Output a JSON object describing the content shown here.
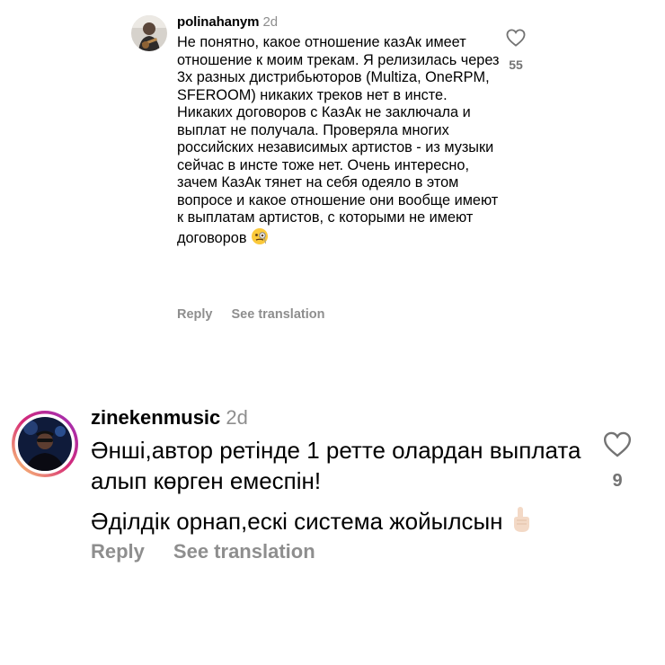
{
  "comments": [
    {
      "username": "polinahanym",
      "time": "2d",
      "text": "Не понятно, какое отношение казАк имеет отношение к моим трекам. Я релизилась через 3х разных дистрибьюторов (Multiza, OneRPM, SFEROOM) никаких треков нет в инсте. Никаких договоров с КазАк не заключала и выплат не получала. Проверяла многих российских независимых артистов - из музыки сейчас в инсте тоже нет. Очень интересно, зачем КазАк тянет на себя одеяло в этом вопросе и какое отношение они вообще имеют к выплатам артистов, с которыми не имеют договоров",
      "emoji": "monocle-face-emoji",
      "likes": "55",
      "reply_label": "Reply",
      "translate_label": "See translation"
    },
    {
      "username": "zinekenmusic",
      "time": "2d",
      "text_line1": "Әнші,автор ретінде 1 ретте олардан выплата алып көрген емеспін!",
      "text_line2": "Әділдік орнап,ескі система жойылсын",
      "emoji": "pointing-up-hand-emoji",
      "likes": "9",
      "reply_label": "Reply",
      "translate_label": "See translation",
      "has_story_ring": true
    }
  ],
  "colors": {
    "secondary_text": "#8e8e8e",
    "like_count": "#737373",
    "story_ring_start": "#feda75",
    "story_ring_mid": "#d62976",
    "story_ring_end": "#962fbf"
  }
}
